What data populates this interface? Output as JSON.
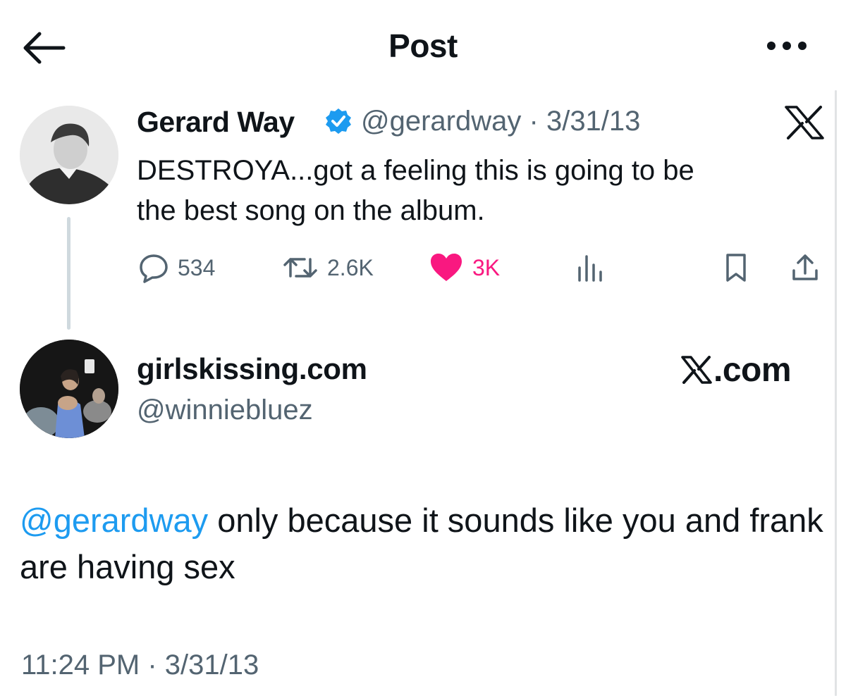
{
  "header": {
    "title": "Post",
    "back_icon": "back-arrow-icon",
    "more_icon": "more-dots-icon"
  },
  "original_tweet": {
    "display_name": "Gerard Way",
    "handle": "@gerardway",
    "separator": "·",
    "date": "3/31/13",
    "text": "DESTROYA...got a feeling this is going to be\nthe best song on the album.",
    "badge_color": "#1d9bf0",
    "actions": {
      "reply_count": "534",
      "retweet_count": "2.6K",
      "like_count": "3K",
      "like_color": "#f91880"
    }
  },
  "reply_tweet": {
    "display_name": "girlskissing.com",
    "handle": "@winniebluez",
    "brand_label": ".com",
    "mention": "@gerardway",
    "text": " only because it sounds like you and frank are having sex",
    "mention_color": "#1d9bf0",
    "timestamp": "11:24 PM · 3/31/13"
  }
}
